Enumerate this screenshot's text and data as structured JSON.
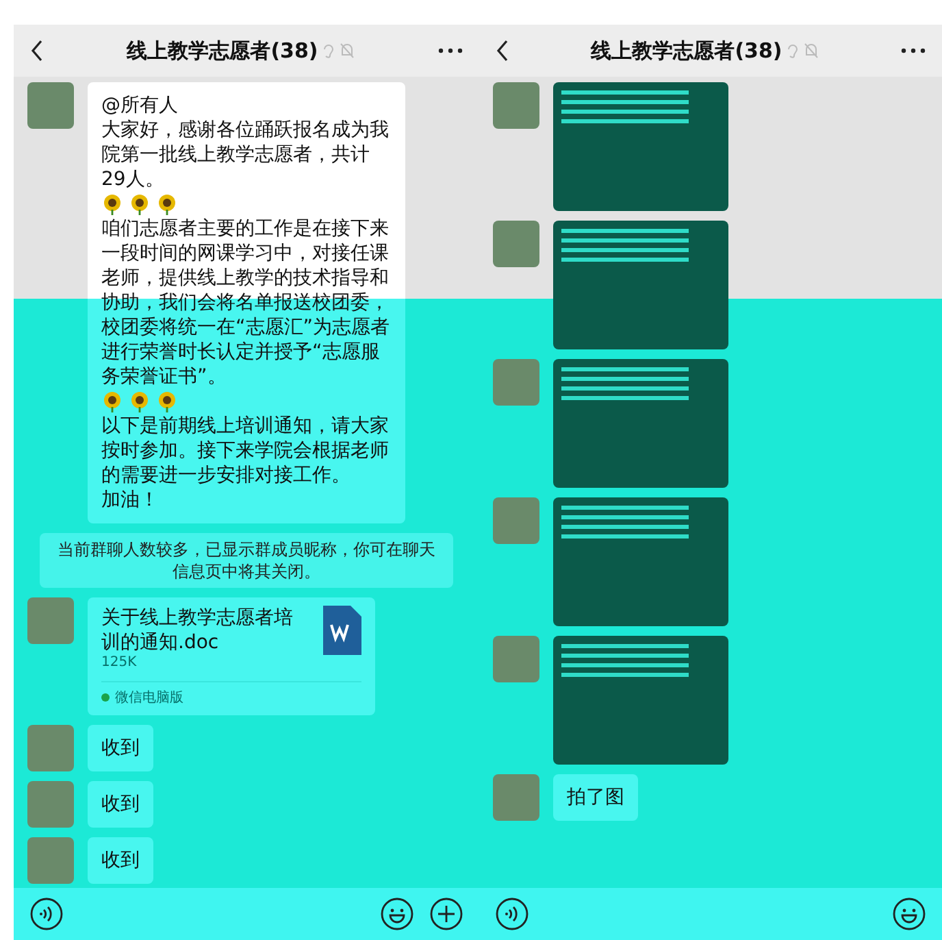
{
  "left_chat": {
    "header": {
      "title": "线上教学志愿者(38)"
    },
    "messages": [
      {
        "kind": "text",
        "paragraphs": [
          {
            "kind": "text",
            "text": "@所有人"
          },
          {
            "kind": "text",
            "text": "大家好，感谢各位踊跃报名成为我院第一批线上教学志愿者，共计29人。"
          },
          {
            "kind": "sunflowers"
          },
          {
            "kind": "text",
            "text": "咱们志愿者主要的工作是在接下来一段时间的网课学习中，对接任课老师，提供线上教学的技术指导和协助，我们会将名单报送校团委，校团委将统一在“志愿汇”为志愿者进行荣誉时长认定并授予“志愿服务荣誉证书”。"
          },
          {
            "kind": "sunflowers"
          },
          {
            "kind": "text",
            "text": "以下是前期线上培训通知，请大家按时参加。接下来学院会根据老师的需要进一步安排对接工作。"
          },
          {
            "kind": "text",
            "text": "加油！"
          }
        ]
      },
      {
        "kind": "notice",
        "text": "当前群聊人数较多，已显示群成员昵称，你可在聊天信息页中将其关闭。"
      },
      {
        "kind": "file",
        "name": "关于线上教学志愿者培训的通知.doc",
        "size": "125K",
        "source": "微信电脑版"
      },
      {
        "kind": "text",
        "paragraphs": [
          {
            "kind": "text",
            "text": "收到"
          }
        ]
      },
      {
        "kind": "text",
        "paragraphs": [
          {
            "kind": "text",
            "text": "收到"
          }
        ]
      },
      {
        "kind": "text",
        "paragraphs": [
          {
            "kind": "text",
            "text": "收到"
          }
        ]
      }
    ]
  },
  "right_chat": {
    "header": {
      "title": "线上教学志愿者(38)"
    },
    "messages": [
      {
        "kind": "image"
      },
      {
        "kind": "image"
      },
      {
        "kind": "image"
      },
      {
        "kind": "image"
      },
      {
        "kind": "image"
      },
      {
        "kind": "text",
        "paragraphs": [
          {
            "kind": "text",
            "text": "拍了图"
          }
        ]
      }
    ]
  }
}
